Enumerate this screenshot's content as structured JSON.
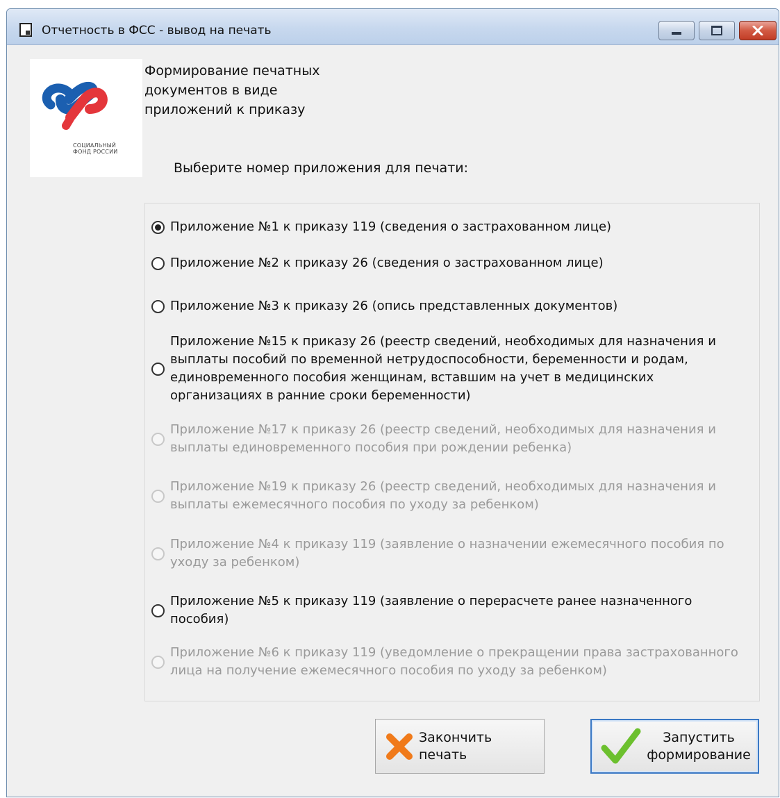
{
  "window": {
    "title": "Отчетность в ФСС - вывод на печать"
  },
  "logo": {
    "caption_line1": "СОЦИАЛЬНЫЙ",
    "caption_line2": "ФОНД РОССИИ",
    "colors": {
      "blue": "#1b5fb0",
      "red": "#e4363b"
    }
  },
  "header": {
    "line1": "Формирование печатных",
    "line2": "документов в виде",
    "line3": "приложений к приказу"
  },
  "choose_label": "Выберите номер приложения для печати:",
  "options": [
    {
      "lines": [
        "Приложение №1 к приказу 119 (сведения о застрахованном лице)"
      ],
      "checked": true,
      "enabled": true
    },
    {
      "lines": [
        "Приложение №2 к приказу 26 (сведения о застрахованном лице)"
      ],
      "checked": false,
      "enabled": true
    },
    {
      "lines": [
        "Приложение №3 к приказу 26 (опись представленных документов)"
      ],
      "checked": false,
      "enabled": true
    },
    {
      "lines": [
        "Приложение №15 к приказу 26 (реестр сведений, необходимых для назначения и",
        "выплаты пособий по временной нетрудоспособности, беременности и родам,",
        "единовременного пособия женщинам, вставшим на учет в медицинских",
        "организациях в ранние сроки беременности)"
      ],
      "checked": false,
      "enabled": true
    },
    {
      "lines": [
        "Приложение №17 к приказу 26 (реестр сведений, необходимых для назначения и",
        "выплаты единовременного пособия при рождении ребенка)"
      ],
      "checked": false,
      "enabled": false
    },
    {
      "lines": [
        "Приложение №19 к приказу 26 (реестр сведений, необходимых для назначения и",
        "выплаты ежемесячного пособия по уходу за ребенком)"
      ],
      "checked": false,
      "enabled": false
    },
    {
      "lines": [
        "Приложение №4 к приказу 119 (заявление о назначении ежемесячного пособия по",
        "уходу за ребенком)"
      ],
      "checked": false,
      "enabled": false
    },
    {
      "lines": [
        "Приложение №5 к приказу 119 (заявление о перерасчете ранее назначенного",
        "пособия)"
      ],
      "checked": false,
      "enabled": true
    },
    {
      "lines": [
        "Приложение №6 к приказу 119 (уведомление о прекращении права застрахованного",
        "лица на получение ежемесячного пособия по уходу за ребенком)"
      ],
      "checked": false,
      "enabled": false
    }
  ],
  "buttons": {
    "finish_label": "Закончить печать",
    "start_line1": "Запустить",
    "start_line2": "формирование"
  },
  "colors": {
    "accent": "#3a78c4",
    "finish_icon": "#f07a1a",
    "start_icon": "#6cc02e",
    "disabled_text": "#9a9a9a"
  }
}
